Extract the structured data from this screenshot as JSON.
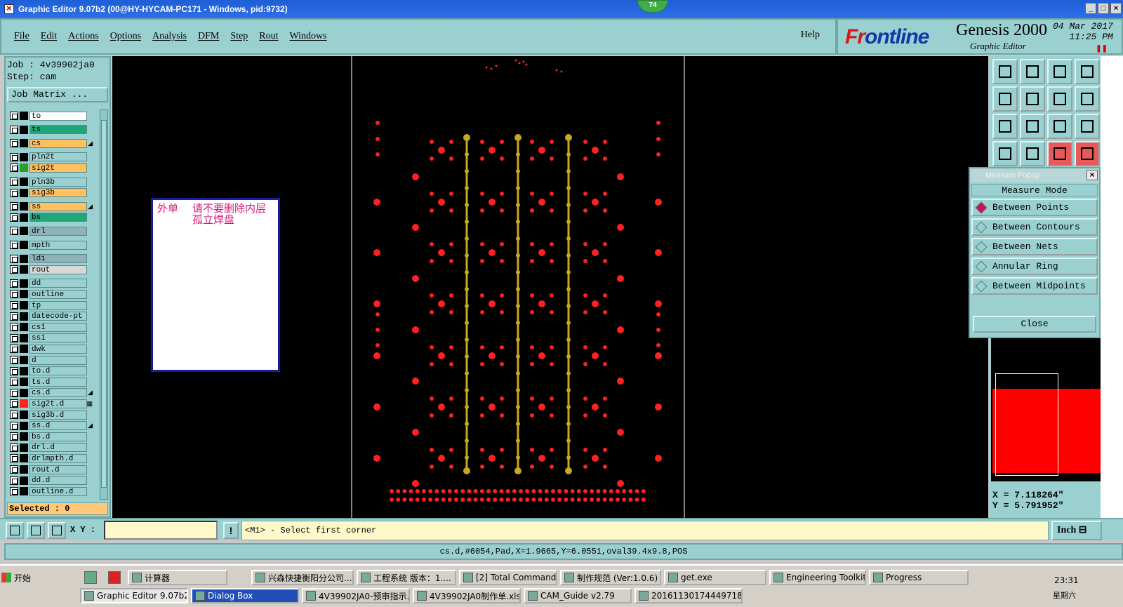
{
  "window": {
    "title": "Graphic Editor 9.07b2 (00@HY-HYCAM-PC171 - Windows, pid:9732)",
    "badge": "74",
    "controls": [
      "_",
      "□",
      "×"
    ]
  },
  "menu": {
    "items": [
      "File",
      "Edit",
      "Actions",
      "Options",
      "Analysis",
      "DFM",
      "Step",
      "Rout",
      "Windows"
    ],
    "help": "Help"
  },
  "brand": {
    "logo_a": "Fr",
    "logo_b": "o",
    "logo_c": "ntline",
    "product": "Genesis 2000",
    "subtitle": "Graphic Editor",
    "date": "04 Mar 2017",
    "time": "11:25 PM"
  },
  "job": {
    "job_line": "Job : 4v39902ja0",
    "step_line": "Step: cam",
    "matrix_label": "Job Matrix ..."
  },
  "layers": [
    {
      "name": "to",
      "color": "#ffffff",
      "swatch": "#000000",
      "mark": ""
    },
    {
      "name": "ts",
      "color": "#1fa77a",
      "swatch": "#000000",
      "mark": ""
    },
    {
      "name": "cs",
      "color": "#ffc060",
      "swatch": "#000000",
      "mark": "◢"
    },
    {
      "name": "pln2t",
      "color": "#9bd0d0",
      "swatch": "#000000",
      "mark": ""
    },
    {
      "name": "sig2t",
      "color": "#ffc060",
      "swatch": "#2aa02a",
      "mark": ""
    },
    {
      "name": "pln3b",
      "color": "#9bd0d0",
      "swatch": "#000000",
      "mark": ""
    },
    {
      "name": "sig3b",
      "color": "#ffc060",
      "swatch": "#000000",
      "mark": ""
    },
    {
      "name": "ss",
      "color": "#ffc060",
      "swatch": "#000000",
      "mark": "◢"
    },
    {
      "name": "bs",
      "color": "#1fa77a",
      "swatch": "#000000",
      "mark": ""
    },
    {
      "name": "drl",
      "color": "#8fb2b8",
      "swatch": "#000000",
      "mark": ""
    },
    {
      "name": "mpth",
      "color": "#9bd0d0",
      "swatch": "#000000",
      "mark": ""
    },
    {
      "name": "ldi",
      "color": "#8fb2b8",
      "swatch": "#000000",
      "mark": ""
    },
    {
      "name": "rout",
      "color": "#d8d8d8",
      "swatch": "#000000",
      "mark": ""
    },
    {
      "name": "dd",
      "color": "#9bd0d0",
      "swatch": "#000000",
      "mark": ""
    },
    {
      "name": "outline",
      "color": "#9bd0d0",
      "swatch": "#000000",
      "mark": ""
    },
    {
      "name": "tp",
      "color": "#9bd0d0",
      "swatch": "#000000",
      "mark": ""
    },
    {
      "name": "datecode-pt",
      "color": "#9bd0d0",
      "swatch": "#000000",
      "mark": ""
    },
    {
      "name": "cs1",
      "color": "#9bd0d0",
      "swatch": "#000000",
      "mark": ""
    },
    {
      "name": "ss1",
      "color": "#9bd0d0",
      "swatch": "#000000",
      "mark": ""
    },
    {
      "name": "dwk",
      "color": "#9bd0d0",
      "swatch": "#000000",
      "mark": ""
    },
    {
      "name": "d",
      "color": "#9bd0d0",
      "swatch": "#000000",
      "mark": ""
    },
    {
      "name": "to.d",
      "color": "#9bd0d0",
      "swatch": "#000000",
      "mark": ""
    },
    {
      "name": "ts.d",
      "color": "#9bd0d0",
      "swatch": "#000000",
      "mark": ""
    },
    {
      "name": "cs.d",
      "color": "#9bd0d0",
      "swatch": "#000000",
      "mark": "◢"
    },
    {
      "name": "sig2t.d",
      "color": "#9bd0d0",
      "swatch": "#ff2020",
      "mark": "▦"
    },
    {
      "name": "sig3b.d",
      "color": "#9bd0d0",
      "swatch": "#000000",
      "mark": ""
    },
    {
      "name": "ss.d",
      "color": "#9bd0d0",
      "swatch": "#000000",
      "mark": "◢"
    },
    {
      "name": "bs.d",
      "color": "#9bd0d0",
      "swatch": "#000000",
      "mark": ""
    },
    {
      "name": "drl.d",
      "color": "#9bd0d0",
      "swatch": "#000000",
      "mark": ""
    },
    {
      "name": "drlmpth.d",
      "color": "#9bd0d0",
      "swatch": "#000000",
      "mark": ""
    },
    {
      "name": "rout.d",
      "color": "#9bd0d0",
      "swatch": "#000000",
      "mark": ""
    },
    {
      "name": "dd.d",
      "color": "#9bd0d0",
      "swatch": "#000000",
      "mark": ""
    },
    {
      "name": "outline.d",
      "color": "#9bd0d0",
      "swatch": "#000000",
      "mark": ""
    }
  ],
  "selected": "Selected : 0",
  "note": {
    "line1a": "外单",
    "line1b": "请不要删除内层",
    "line2": "孤立焊盘"
  },
  "measure_popup": {
    "title": "Measure Popup",
    "mode_label": "Measure Mode",
    "options": [
      {
        "label": "Between Points",
        "selected": true
      },
      {
        "label": "Between Contours",
        "selected": false
      },
      {
        "label": "Between Nets",
        "selected": false
      },
      {
        "label": "Annular Ring",
        "selected": false
      },
      {
        "label": "Between Midpoints",
        "selected": false
      }
    ],
    "close_label": "Close"
  },
  "coords": {
    "x": "X =  7.118264\"",
    "y": "Y =  5.791952\""
  },
  "command": {
    "xy_label": "X Y :",
    "xy_value": "",
    "bang": "!",
    "prompt": "<M1> - Select first corner",
    "units": "Inch ⊟"
  },
  "status": "cs.d,#6054,Pad,X=1.9665,Y=6.0551,oval39.4x9.8,POS",
  "taskbar": {
    "start": "开始",
    "row1": [
      "计算器",
      "兴森快捷衡阳分公司...",
      "工程系统  版本：1....",
      "[2] Total Commander ...",
      "制作规范 (Ver:1.0.6)",
      "get.exe",
      "Engineering Toolkit 9....",
      "Progress"
    ],
    "row2": [
      "Graphic Editor 9.07b2",
      "Dialog Box",
      "4V39902JA0-预审指示...",
      "4V39902JA0制作单.xls",
      "CAM_Guide v2.79",
      "20161130174449718.rtf"
    ],
    "clock": "23:31",
    "day": "星期六"
  },
  "colors": {
    "panel": "#9bd0d0",
    "pad": "#ff2020",
    "trace": "#c8a820"
  }
}
